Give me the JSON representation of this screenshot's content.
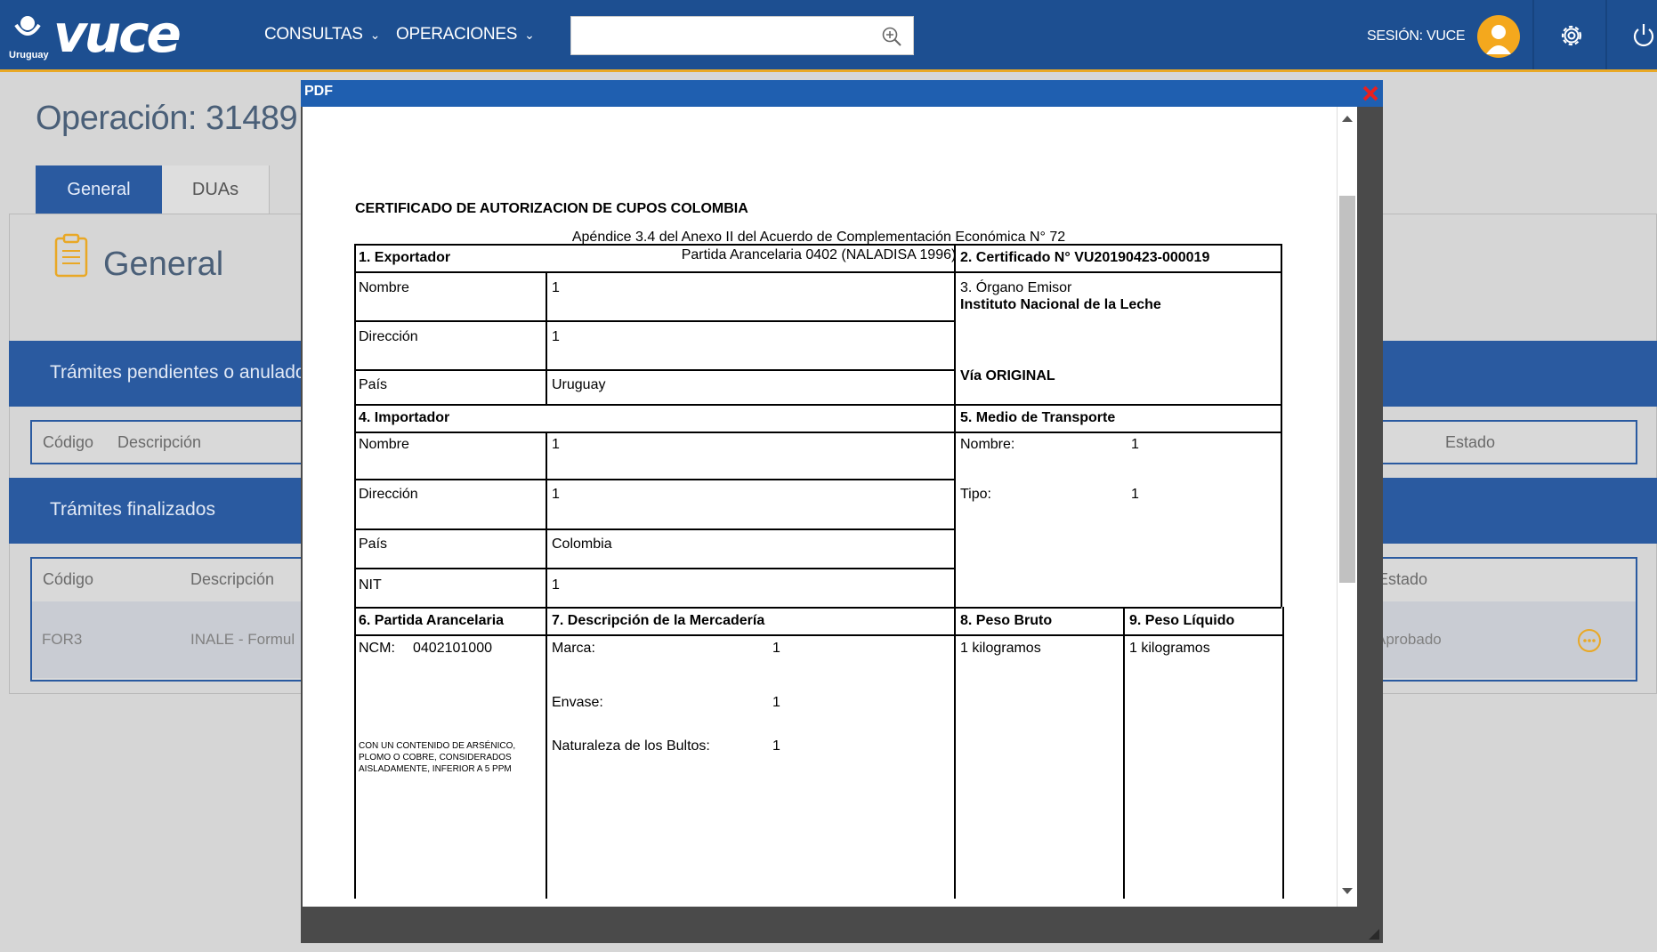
{
  "app": {
    "logo_country": "Uruguay",
    "logo_text": "vuce"
  },
  "header": {
    "nav": [
      {
        "label": "CONSULTAS"
      },
      {
        "label": "OPERACIONES"
      }
    ],
    "search": {
      "value": "",
      "placeholder": ""
    },
    "session_label": "SESIÓN: VUCE",
    "colors": {
      "bar": "#1d4f91",
      "accent": "#e9a825",
      "avatar": "#f4a81d"
    }
  },
  "page": {
    "operation_title": "Operación: 31489",
    "tabs": [
      {
        "label": "General"
      },
      {
        "label": "DUAs"
      }
    ],
    "section_title": "General",
    "pending": {
      "title": "Trámites pendientes o anulados",
      "columns": [
        "Código",
        "Descripción",
        "Estado"
      ]
    },
    "finished": {
      "title": "Trámites finalizados",
      "columns": [
        "Código",
        "Descripción",
        "Estado"
      ],
      "rows": [
        {
          "codigo": "FOR3",
          "descripcion": "INALE - Formul",
          "estado": "Aprobado"
        }
      ]
    }
  },
  "modal": {
    "title": "PDF",
    "certificate": {
      "title": "CERTIFICADO DE AUTORIZACION DE CUPOS COLOMBIA",
      "subtitle_1": "Apéndice 3.4 del Anexo II del Acuerdo de Complementación Económica N° 72",
      "subtitle_2": "Partida Arancelaria 0402 (NALADISA 1996)",
      "exportador": {
        "heading": "1. Exportador",
        "nombre_label": "Nombre",
        "nombre": "1",
        "direccion_label": "Dirección",
        "direccion": "1",
        "pais_label": "País",
        "pais": "Uruguay"
      },
      "certificado": {
        "heading": "2. Certificado N° VU20190423-000019",
        "organo_label": "3. Órgano Emisor",
        "organo": "Instituto Nacional de la Leche",
        "via": "Vía ORIGINAL"
      },
      "importador": {
        "heading": "4. Importador",
        "nombre_label": "Nombre",
        "nombre": "1",
        "direccion_label": "Dirección",
        "direccion": "1",
        "pais_label": "País",
        "pais": "Colombia",
        "nit_label": "NIT",
        "nit": "1"
      },
      "transporte": {
        "heading": "5. Medio de Transporte",
        "nombre_label": "Nombre:",
        "nombre": "1",
        "tipo_label": "Tipo:",
        "tipo": "1"
      },
      "partida": {
        "heading": "6. Partida Arancelaria",
        "ncm_label": "NCM:",
        "ncm": "0402101000",
        "note_1": "CON UN CONTENIDO DE ARSÉNICO,",
        "note_2": "PLOMO O COBRE, CONSIDERADOS",
        "note_3": "AISLADAMENTE, INFERIOR A 5 PPM"
      },
      "mercaderia": {
        "heading": "7. Descripción de la Mercadería",
        "marca_label": "Marca:",
        "marca": "1",
        "envase_label": "Envase:",
        "envase": "1",
        "naturaleza_label": "Naturaleza de los Bultos:",
        "naturaleza": "1"
      },
      "peso_bruto": {
        "heading": "8. Peso Bruto",
        "value": "1 kilogramos"
      },
      "peso_liquido": {
        "heading": "9. Peso Líquido",
        "value": "1 kilogramos"
      }
    }
  }
}
